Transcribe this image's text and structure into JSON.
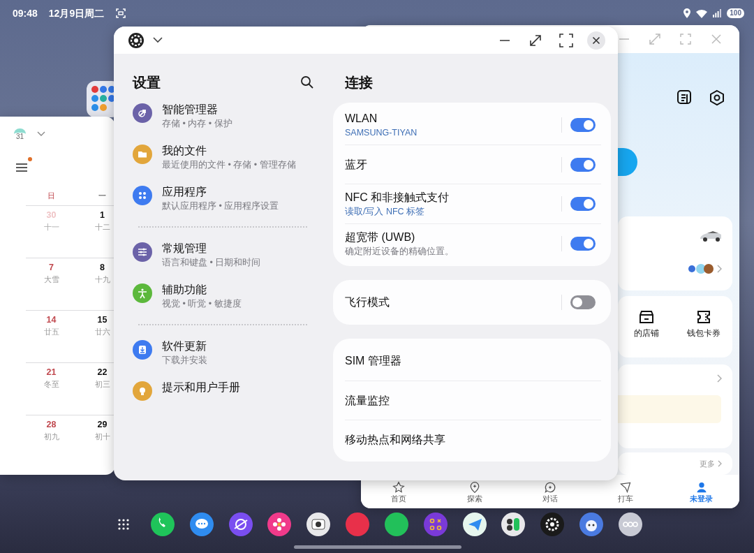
{
  "status_bar": {
    "time": "09:48",
    "date": "12月9日周二",
    "battery": "100"
  },
  "calendar_window": {
    "app_icon_label": "31",
    "menu_badge": true,
    "weekdays": [
      {
        "label": "日",
        "kind": "sunday"
      },
      {
        "label": "一",
        "kind": "normal"
      }
    ],
    "weeks": [
      [
        {
          "date": "30",
          "lunar": "十一",
          "kind": "outside"
        },
        {
          "date": "1",
          "lunar": "十二",
          "kind": "normal"
        }
      ],
      [
        {
          "date": "7",
          "lunar": "大雪",
          "kind": "sunday"
        },
        {
          "date": "8",
          "lunar": "十九",
          "kind": "normal"
        }
      ],
      [
        {
          "date": "14",
          "lunar": "廿五",
          "kind": "sunday"
        },
        {
          "date": "15",
          "lunar": "廿六",
          "kind": "normal"
        }
      ],
      [
        {
          "date": "21",
          "lunar": "冬至",
          "kind": "sunday"
        },
        {
          "date": "22",
          "lunar": "初三",
          "kind": "normal"
        }
      ],
      [
        {
          "date": "28",
          "lunar": "初九",
          "kind": "sunday"
        },
        {
          "date": "29",
          "lunar": "初十",
          "kind": "normal"
        }
      ]
    ]
  },
  "settings_window": {
    "sidebar_title": "设置",
    "groups": [
      [
        {
          "title": "智能管理器",
          "subtitle": "存储 • 内存 • 保护",
          "color": "#6b62a8"
        },
        {
          "title": "我的文件",
          "subtitle": "最近使用的文件 • 存储 • 管理存储",
          "color": "#e2a63b"
        },
        {
          "title": "应用程序",
          "subtitle": "默认应用程序 • 应用程序设置",
          "color": "#3e7bf0"
        }
      ],
      [
        {
          "title": "常规管理",
          "subtitle": "语言和键盘 • 日期和时间",
          "color": "#6b62a8"
        },
        {
          "title": "辅助功能",
          "subtitle": "视觉 • 听觉 • 敏捷度",
          "color": "#5cb83c"
        }
      ],
      [
        {
          "title": "软件更新",
          "subtitle": "下载并安装",
          "color": "#3e7bf0"
        },
        {
          "title": "提示和用户手册",
          "color": "#e2a63b"
        }
      ]
    ],
    "detail_title": "连接",
    "cards": [
      {
        "rows": [
          {
            "kind": "toggle",
            "title": "WLAN",
            "subtitle": "SAMSUNG-TIYAN",
            "subtitle_accent": true,
            "on": true
          },
          {
            "kind": "toggle",
            "title": "蓝牙",
            "on": true
          },
          {
            "kind": "toggle",
            "title": "NFC 和非接触式支付",
            "subtitle": "读取/写入 NFC 标签",
            "subtitle_accent": true,
            "on": true
          },
          {
            "kind": "toggle",
            "title": "超宽带 (UWB)",
            "subtitle": "确定附近设备的精确位置。",
            "subtitle_accent": false,
            "on": true
          }
        ]
      },
      {
        "rows": [
          {
            "kind": "toggle",
            "title": "飞行模式",
            "on": false
          }
        ]
      },
      {
        "rows": [
          {
            "kind": "link",
            "title": "SIM 管理器"
          },
          {
            "kind": "link",
            "title": "流量监控"
          },
          {
            "kind": "link",
            "title": "移动热点和网络共享"
          }
        ]
      }
    ]
  },
  "back_window": {
    "shortcuts": [
      {
        "label": "的店铺"
      },
      {
        "label": "钱包卡券"
      }
    ],
    "more_link": "更多",
    "nav": [
      {
        "label": "首页",
        "selected": false
      },
      {
        "label": "探索",
        "selected": false
      },
      {
        "label": "对话",
        "selected": false
      },
      {
        "label": "打车",
        "selected": false
      },
      {
        "label": "未登录",
        "selected": true
      }
    ]
  }
}
